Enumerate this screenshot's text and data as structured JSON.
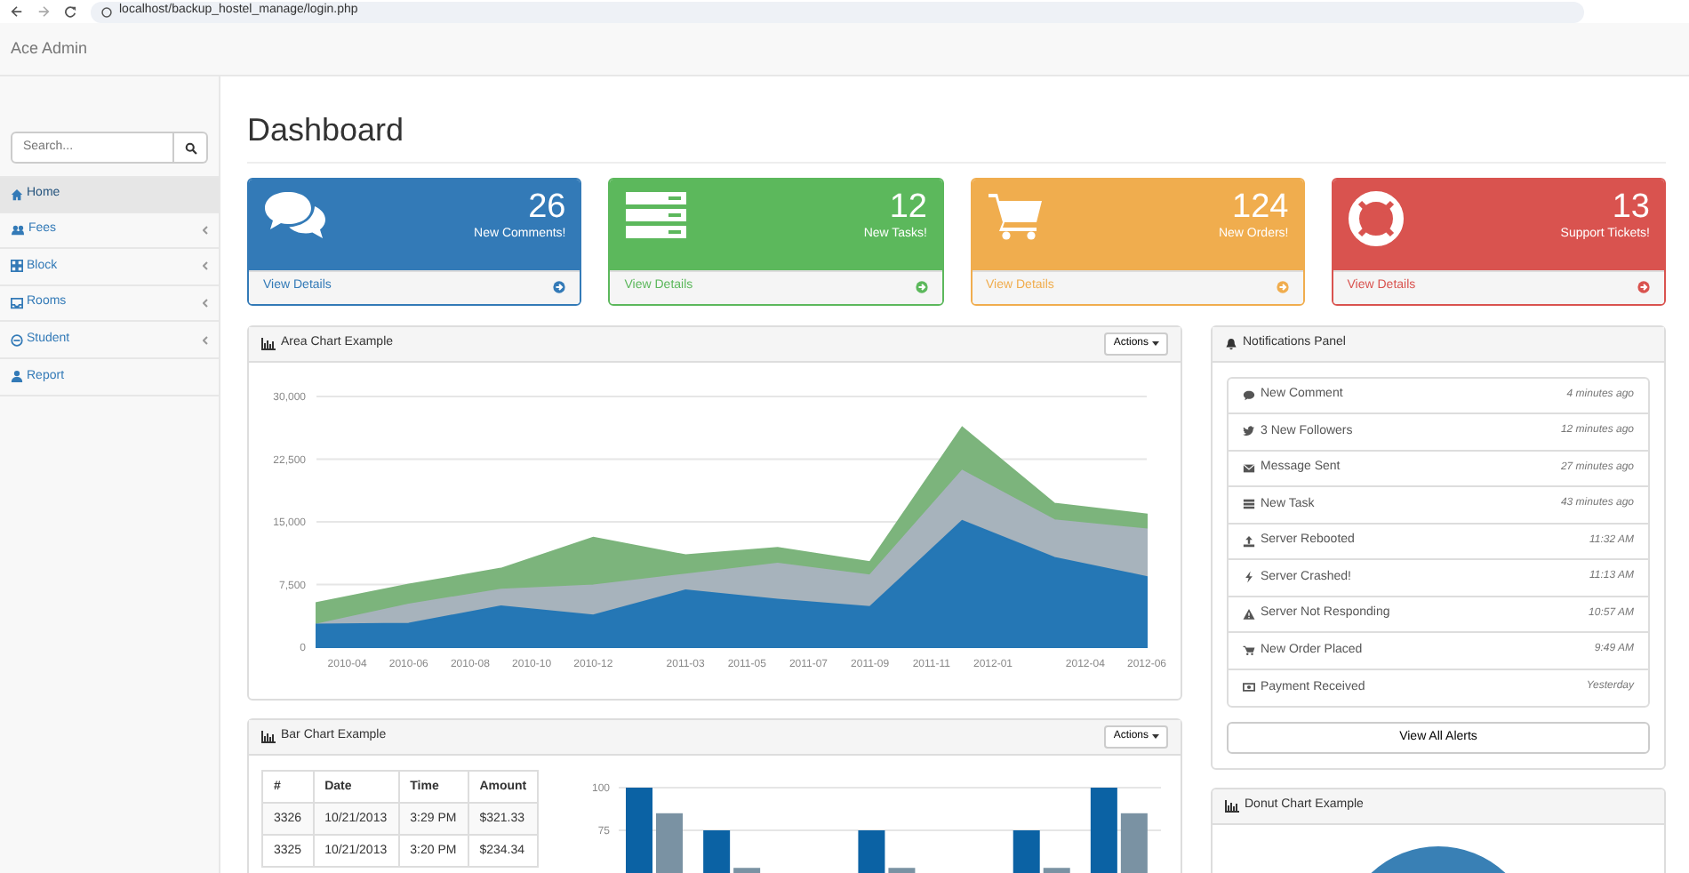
{
  "browser": {
    "url": "localhost/backup_hostel_manage/login.php"
  },
  "navbar": {
    "brand": "Ace Admin"
  },
  "sidebar": {
    "search": {
      "placeholder": "Search..."
    },
    "items": [
      {
        "label": "Home",
        "selected": true,
        "has_submenu": false
      },
      {
        "label": "Fees",
        "selected": false,
        "has_submenu": true
      },
      {
        "label": "Block",
        "selected": false,
        "has_submenu": true
      },
      {
        "label": "Rooms",
        "selected": false,
        "has_submenu": true
      },
      {
        "label": "Student",
        "selected": false,
        "has_submenu": true
      },
      {
        "label": "Report",
        "selected": false,
        "has_submenu": false
      }
    ]
  },
  "page_title": "Dashboard",
  "stat_cards": [
    {
      "count": "26",
      "label": "New Comments!",
      "link": "View Details",
      "color": "#337ab7"
    },
    {
      "count": "12",
      "label": "New Tasks!",
      "link": "View Details",
      "color": "#5cb85c"
    },
    {
      "count": "124",
      "label": "New Orders!",
      "link": "View Details",
      "color": "#f0ad4e"
    },
    {
      "count": "13",
      "label": "Support Tickets!",
      "link": "View Details",
      "color": "#d9534f"
    }
  ],
  "area_panel": {
    "title": "Area Chart Example",
    "actions": "Actions",
    "chart_data": {
      "type": "area",
      "stacked": true,
      "grid": true,
      "categories": [
        null,
        "2010-04",
        null,
        "2010-06",
        null,
        "2010-08",
        null,
        "2010-10",
        null,
        "2010-12",
        null,
        null,
        "2011-03",
        null,
        "2011-05",
        null,
        "2011-07",
        null,
        "2011-09",
        null,
        "2011-11",
        null,
        "2012-01",
        null,
        null,
        "2012-04",
        null,
        "2012-06"
      ],
      "yticks": [
        {
          "value": 0,
          "label": "0"
        },
        {
          "value": 7500,
          "label": "7,500"
        },
        {
          "value": 15000,
          "label": "15,000"
        },
        {
          "value": 22500,
          "label": "22,500"
        },
        {
          "value": 30000,
          "label": "30,000"
        }
      ],
      "ylim": [
        0,
        30000
      ],
      "series": [
        {
          "color": "#2577b5",
          "values": [
            2700,
            null,
            null,
            2800,
            null,
            null,
            4900,
            null,
            null,
            3800,
            null,
            null,
            6800,
            null,
            null,
            5700,
            null,
            null,
            4800,
            null,
            null,
            15100,
            null,
            null,
            10700,
            null,
            null,
            8400
          ]
        },
        {
          "color": "#a7b3bc",
          "values": [
            0,
            null,
            null,
            2300,
            null,
            null,
            2000,
            null,
            null,
            3600,
            null,
            null,
            1900,
            null,
            null,
            4300,
            null,
            null,
            3800,
            null,
            null,
            6000,
            null,
            null,
            4500,
            null,
            null,
            5700
          ]
        },
        {
          "color": "#7cb47c",
          "values": [
            2600,
            null,
            null,
            2400,
            null,
            null,
            2500,
            null,
            null,
            5700,
            null,
            null,
            2300,
            null,
            null,
            1900,
            null,
            null,
            1600,
            null,
            null,
            5200,
            null,
            null,
            2000,
            null,
            null,
            1800
          ]
        }
      ]
    }
  },
  "bar_panel": {
    "title": "Bar Chart Example",
    "actions": "Actions",
    "table": {
      "columns": [
        "#",
        "Date",
        "Time",
        "Amount"
      ],
      "rows": [
        [
          "3326",
          "10/21/2013",
          "3:29 PM",
          "$321.33"
        ],
        [
          "3325",
          "10/21/2013",
          "3:20 PM",
          "$234.34"
        ]
      ]
    },
    "chart_data": {
      "type": "bar",
      "stacked": false,
      "grid": true,
      "ylim": [
        0,
        100
      ],
      "yticks": [
        75,
        100
      ],
      "series": [
        {
          "color": "#0b62a4",
          "values": [
            100,
            75,
            null,
            75,
            null,
            75,
            100
          ]
        },
        {
          "color": "#7a92a3",
          "values": [
            85,
            53,
            null,
            53,
            null,
            53,
            85
          ]
        }
      ]
    }
  },
  "notifications": {
    "title": "Notifications Panel",
    "items": [
      {
        "text": "New Comment",
        "time": "4 minutes ago"
      },
      {
        "text": "3 New Followers",
        "time": "12 minutes ago"
      },
      {
        "text": "Message Sent",
        "time": "27 minutes ago"
      },
      {
        "text": "New Task",
        "time": "43 minutes ago"
      },
      {
        "text": "Server Rebooted",
        "time": "11:32 AM"
      },
      {
        "text": "Server Crashed!",
        "time": "11:13 AM"
      },
      {
        "text": "Server Not Responding",
        "time": "10:57 AM"
      },
      {
        "text": "New Order Placed",
        "time": "9:49 AM"
      },
      {
        "text": "Payment Received",
        "time": "Yesterday"
      }
    ],
    "button": "View All Alerts"
  },
  "donut_panel": {
    "title": "Donut Chart Example"
  }
}
